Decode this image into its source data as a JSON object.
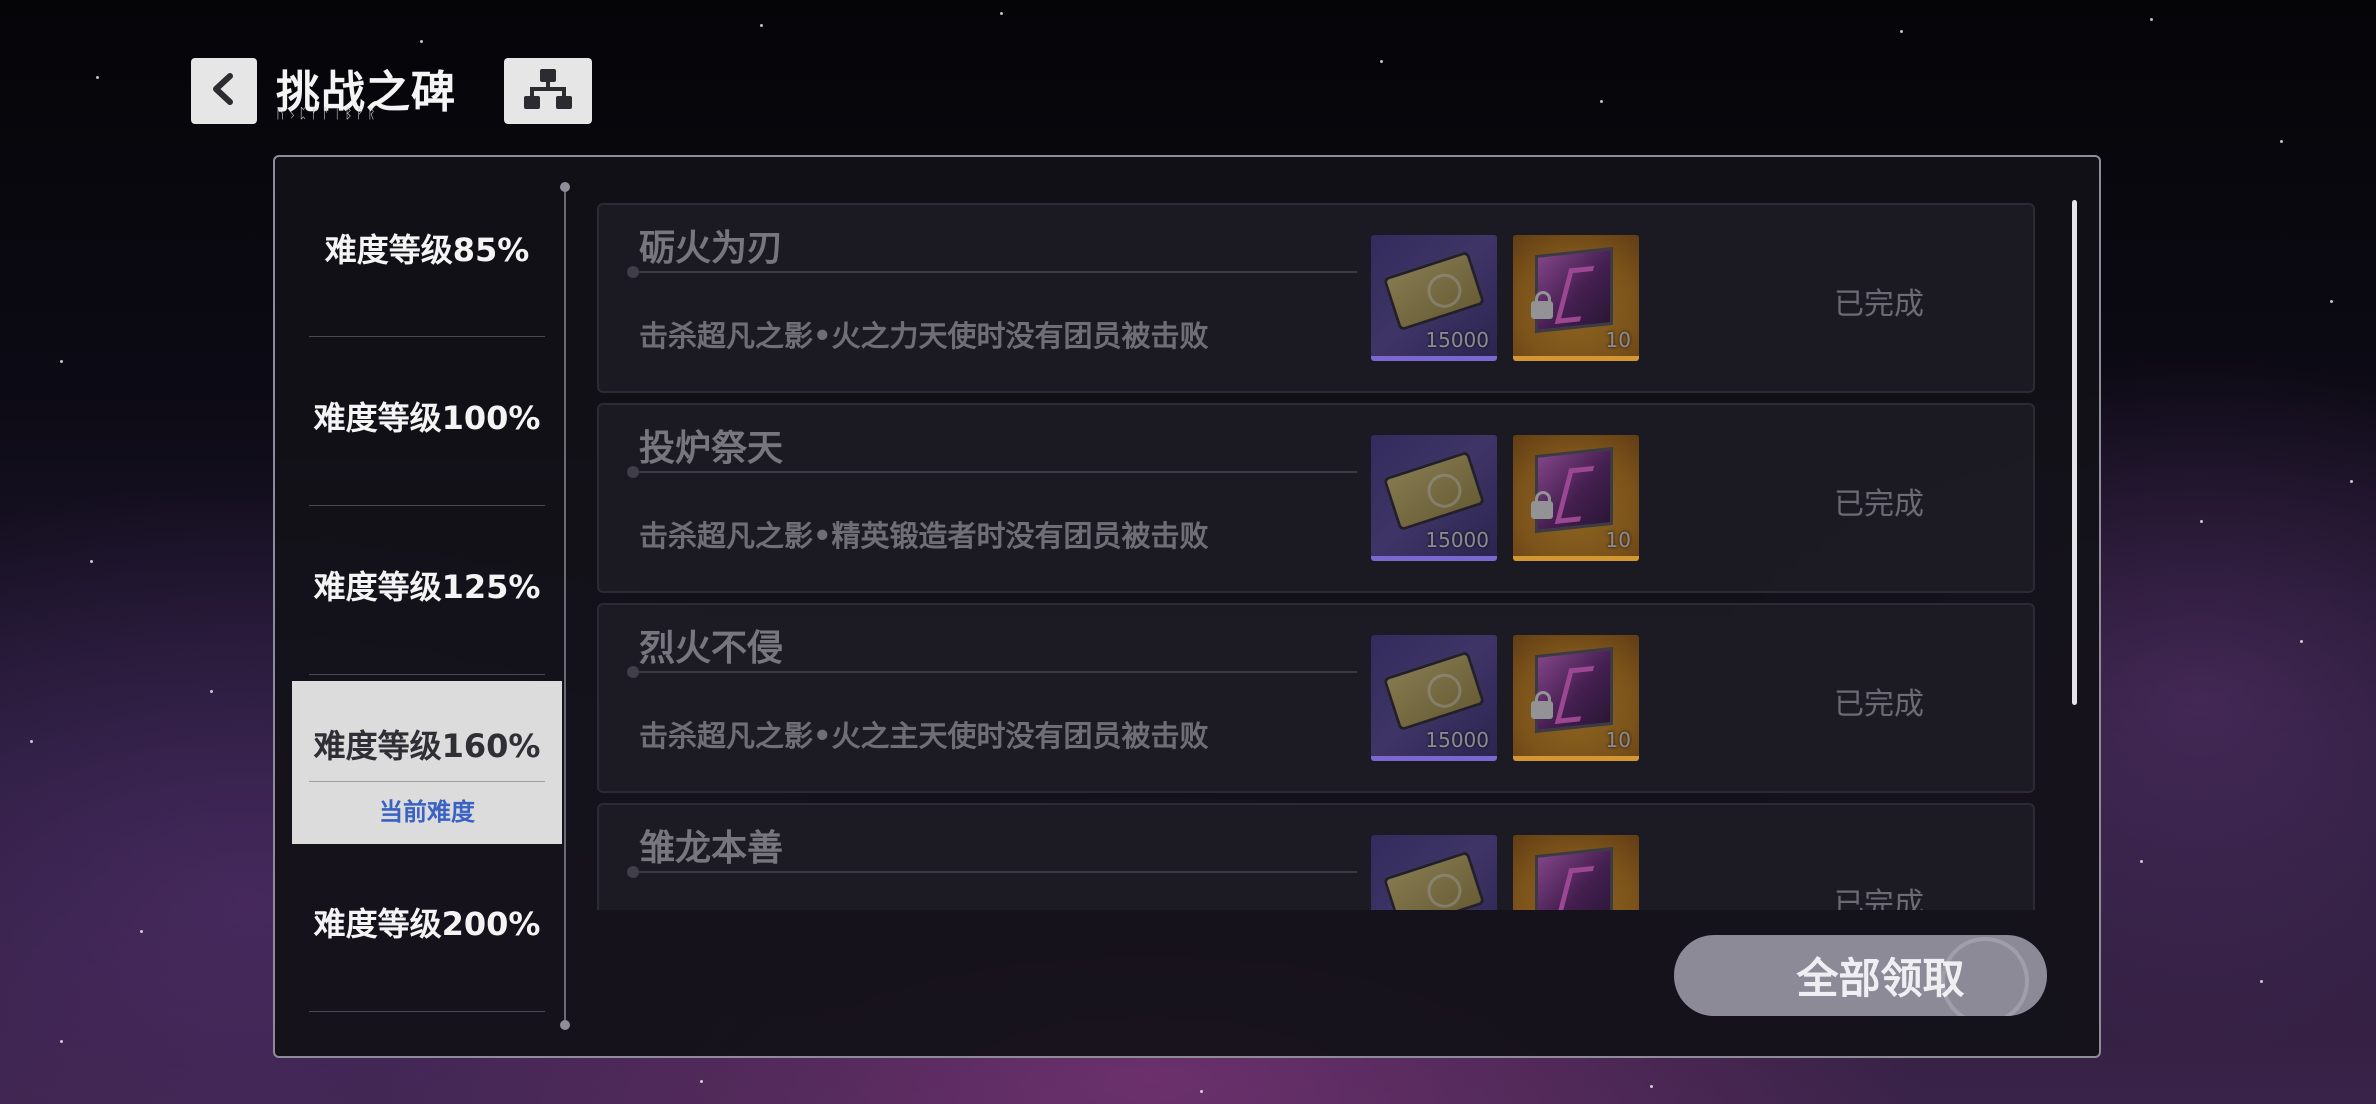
{
  "header": {
    "title": "挑战之碑",
    "subtitle": "ᚢᛊᛈᚠᚨᛁᛒᚹᚱ",
    "back_icon": "chevron-left-icon",
    "tree_icon": "hierarchy-icon"
  },
  "difficulties": [
    {
      "label": "难度等级85%"
    },
    {
      "label": "难度等级100%"
    },
    {
      "label": "难度等级125%"
    },
    {
      "label": "难度等级160%",
      "current_label": "当前难度"
    },
    {
      "label": "难度等级200%"
    }
  ],
  "tasks": [
    {
      "name": "砺火为刃",
      "desc": "击杀超凡之影•火之力天使时没有团员被击败",
      "reward1": "15000",
      "reward2": "10",
      "status": "已完成"
    },
    {
      "name": "投炉祭天",
      "desc": "击杀超凡之影•精英锻造者时没有团员被击败",
      "reward1": "15000",
      "reward2": "10",
      "status": "已完成"
    },
    {
      "name": "烈火不侵",
      "desc": "击杀超凡之影•火之主天使时没有团员被击败",
      "reward1": "15000",
      "reward2": "10",
      "status": "已完成"
    },
    {
      "name": "雏龙本善",
      "desc": "",
      "reward1": "",
      "reward2": "",
      "status": "已完成"
    }
  ],
  "claim_all": "全部领取"
}
